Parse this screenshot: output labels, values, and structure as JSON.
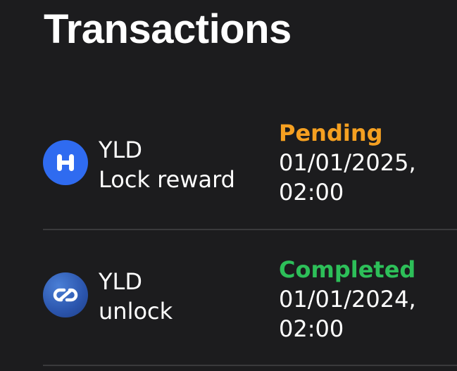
{
  "header": {
    "title": "Transactions"
  },
  "transactions": [
    {
      "token": "YLD",
      "action": "Lock reward",
      "status": "Pending",
      "date": "01/01/2025,",
      "time": "02:00",
      "icon": "h-logo-icon",
      "status_color": "#f5a021"
    },
    {
      "token": "YLD",
      "action": "unlock",
      "status": "Completed",
      "date": "01/01/2024,",
      "time": "02:00",
      "icon": "infinity-link-icon",
      "status_color": "#2dbf59"
    }
  ],
  "colors": {
    "background": "#1c1c1e",
    "divider": "#3a3a3c",
    "icon_blue": "#2f6bf0"
  }
}
